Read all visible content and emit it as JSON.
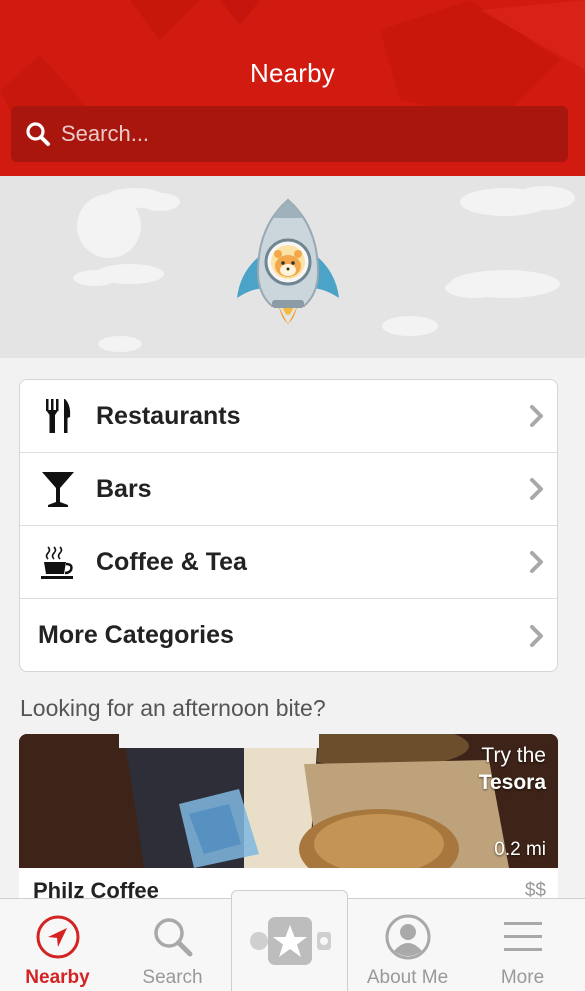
{
  "header": {
    "title": "Nearby",
    "search_placeholder": "Search..."
  },
  "categories": [
    {
      "label": "Restaurants",
      "icon": "fork-knife-icon"
    },
    {
      "label": "Bars",
      "icon": "cocktail-icon"
    },
    {
      "label": "Coffee & Tea",
      "icon": "coffee-cup-icon"
    },
    {
      "label": "More Categories",
      "icon": ""
    }
  ],
  "promo": {
    "section_title": "Looking for an afternoon bite?",
    "try_prefix": "Try the",
    "try_item": "Tesora",
    "distance": "0.2 mi",
    "business_name": "Philz Coffee",
    "price": "$$"
  },
  "tabbar": {
    "tabs": [
      {
        "label": "Nearby",
        "icon": "compass-icon",
        "active": true
      },
      {
        "label": "Search",
        "icon": "search-icon",
        "active": false
      },
      {
        "label": "",
        "icon": "check-in-star-icon",
        "active": false
      },
      {
        "label": "About Me",
        "icon": "profile-icon",
        "active": false
      },
      {
        "label": "More",
        "icon": "hamburger-menu-icon",
        "active": false
      }
    ]
  },
  "colors": {
    "brand_red": "#d11a10",
    "search_bg": "#a8160d",
    "active_tab": "#d32323"
  }
}
